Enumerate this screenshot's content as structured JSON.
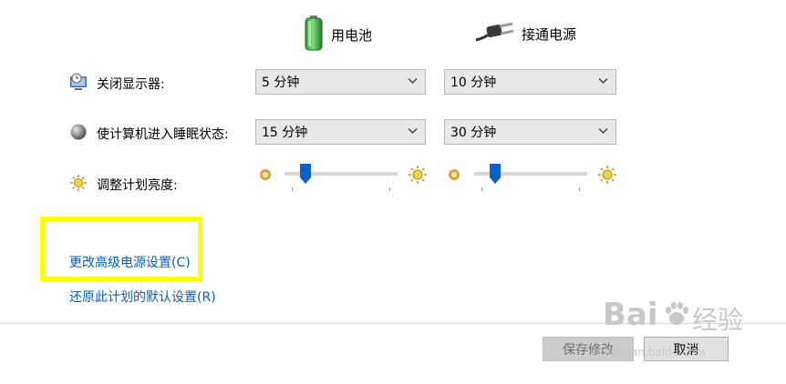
{
  "columns": {
    "battery_label": "用电池",
    "plugged_label": "接通电源"
  },
  "rows": {
    "display_off": {
      "label": "关闭显示器:",
      "battery_value": "5 分钟",
      "plugged_value": "10 分钟"
    },
    "sleep": {
      "label": "使计算机进入睡眠状态:",
      "battery_value": "15 分钟",
      "plugged_value": "30 分钟"
    },
    "brightness": {
      "label": "调整计划亮度:",
      "battery_level": 0.15,
      "plugged_level": 0.15
    }
  },
  "links": {
    "advanced": "更改高级电源设置(C)",
    "restore": "还原此计划的默认设置(R)"
  },
  "buttons": {
    "save": "保存修改",
    "cancel": "取消"
  },
  "watermark": {
    "brand": "Bai",
    "brand_cn": "经验",
    "url": "jingyan.baidu.com"
  },
  "colors": {
    "link": "#0b5fb3",
    "highlight": "#ffff00",
    "thumb": "#0a62c4"
  }
}
